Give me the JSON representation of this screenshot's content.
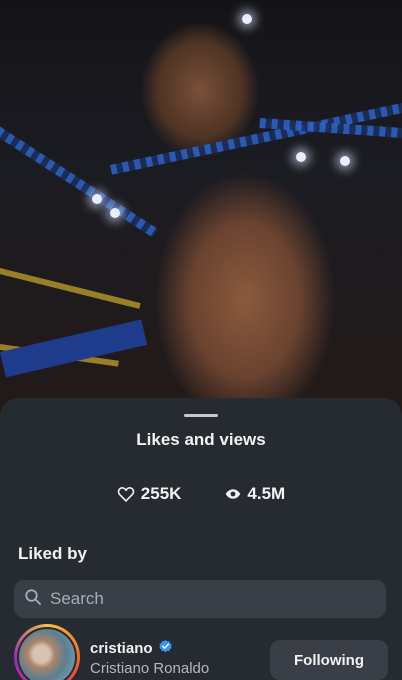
{
  "sheet": {
    "title": "Likes and views",
    "likes_count": "255K",
    "views_count": "4.5M",
    "liked_by_label": "Liked by"
  },
  "search": {
    "placeholder": "Search"
  },
  "liked_by": [
    {
      "username": "cristiano",
      "full_name": "Cristiano Ronaldo",
      "verified": true,
      "button_label": "Following"
    }
  ],
  "icons": {
    "likes": "heart-icon",
    "views": "eye-icon",
    "search": "search-icon",
    "verified": "verified-badge-icon"
  },
  "colors": {
    "sheet_background": "#262a31",
    "field_background": "#3a3e46",
    "verified_blue": "#3897f0"
  }
}
